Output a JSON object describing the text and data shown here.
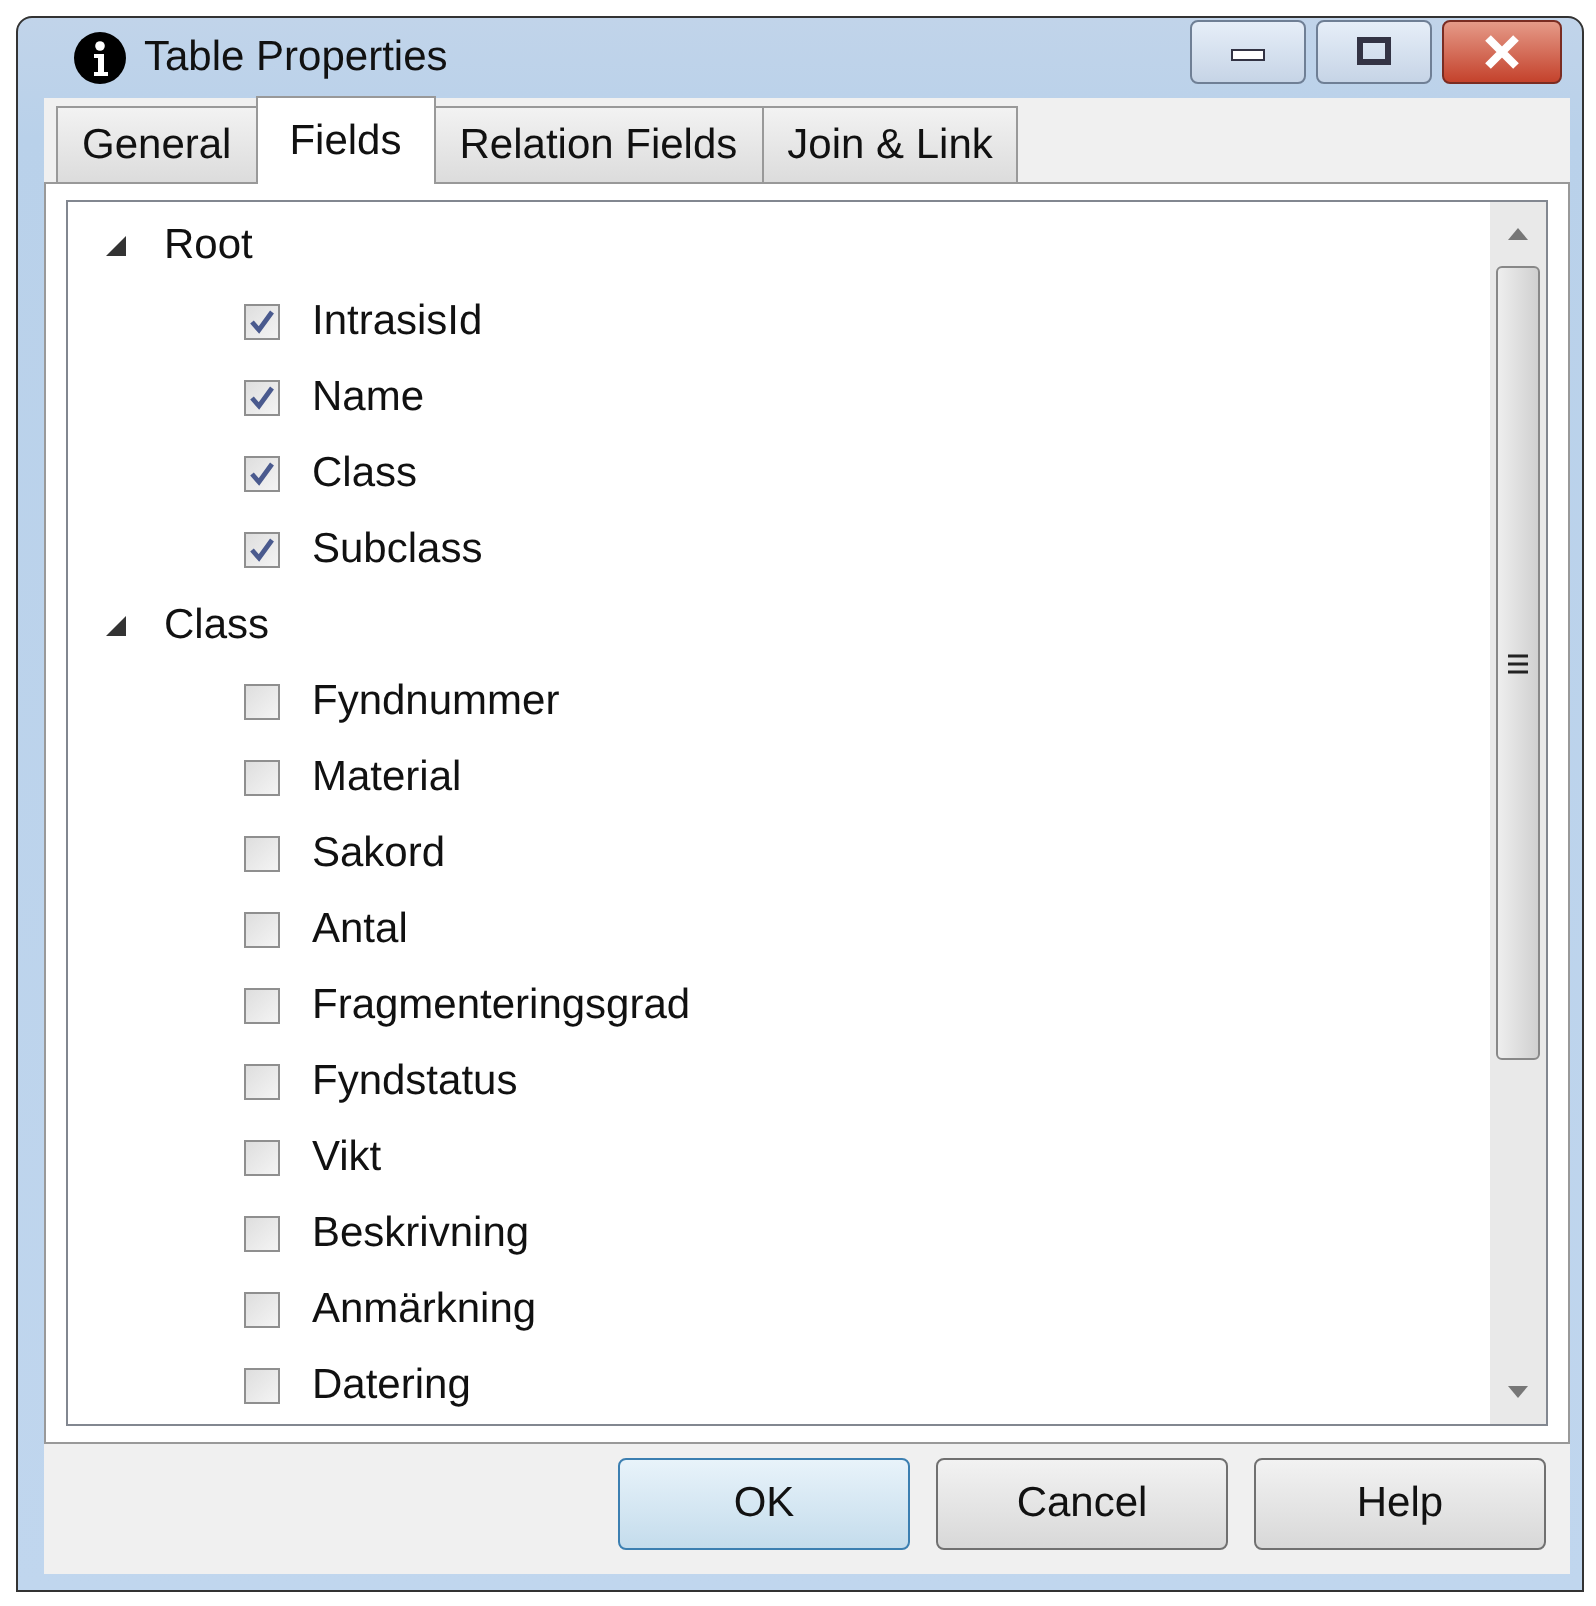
{
  "window": {
    "title": "Table Properties"
  },
  "tabs": [
    {
      "label": "General",
      "selected": false
    },
    {
      "label": "Fields",
      "selected": true
    },
    {
      "label": "Relation Fields",
      "selected": false
    },
    {
      "label": "Join & Link",
      "selected": false
    }
  ],
  "tree": [
    {
      "label": "Root",
      "expanded": true,
      "children": [
        {
          "label": "IntrasisId",
          "checked": true
        },
        {
          "label": "Name",
          "checked": true
        },
        {
          "label": "Class",
          "checked": true
        },
        {
          "label": "Subclass",
          "checked": true
        }
      ]
    },
    {
      "label": "Class",
      "expanded": true,
      "children": [
        {
          "label": "Fyndnummer",
          "checked": false
        },
        {
          "label": "Material",
          "checked": false
        },
        {
          "label": "Sakord",
          "checked": false
        },
        {
          "label": "Antal",
          "checked": false
        },
        {
          "label": "Fragmenteringsgrad",
          "checked": false
        },
        {
          "label": "Fyndstatus",
          "checked": false
        },
        {
          "label": "Vikt",
          "checked": false
        },
        {
          "label": "Beskrivning",
          "checked": false
        },
        {
          "label": "Anmärkning",
          "checked": false
        },
        {
          "label": "Datering",
          "checked": false
        }
      ]
    }
  ],
  "buttons": [
    {
      "label": "OK",
      "kind": "default"
    },
    {
      "label": "Cancel",
      "kind": "normal"
    },
    {
      "label": "Help",
      "kind": "normal"
    }
  ]
}
